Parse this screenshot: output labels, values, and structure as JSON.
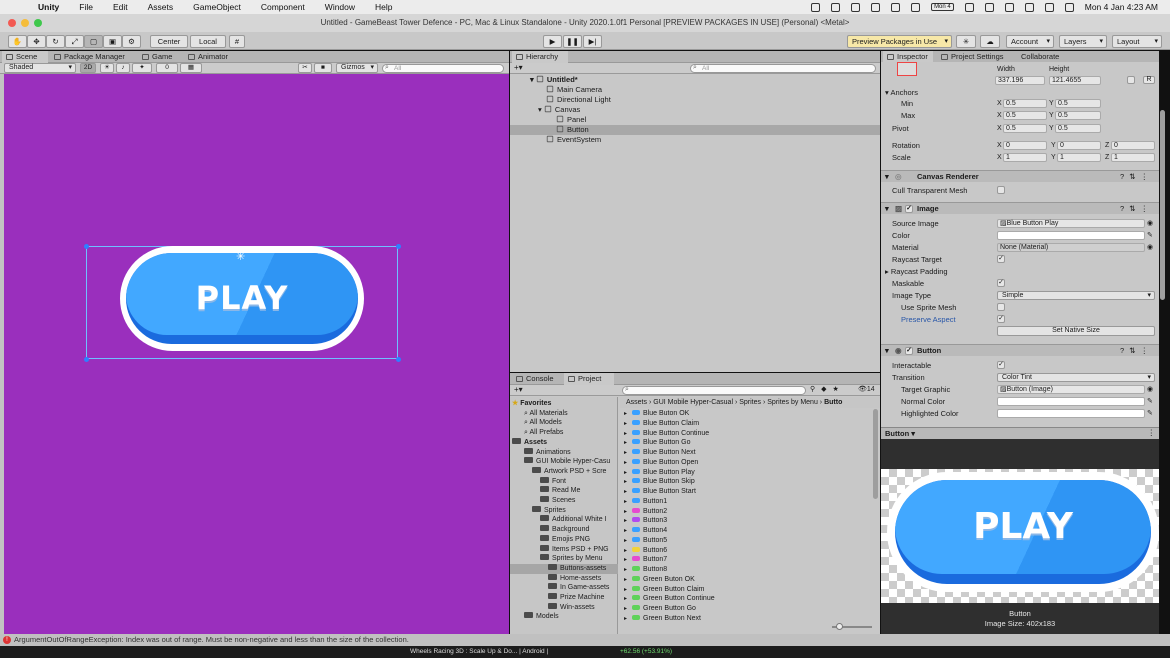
{
  "menubar": {
    "app": "Unity",
    "items": [
      "File",
      "Edit",
      "Assets",
      "GameObject",
      "Component",
      "Window",
      "Help"
    ],
    "badge": "Mon 4",
    "datetime": "Mon 4 Jan  4:23 AM"
  },
  "window": {
    "title": "Untitled - GameBeast Tower Defence - PC, Mac & Linux Standalone - Unity 2020.1.0f1 Personal [PREVIEW PACKAGES IN USE] (Personal) <Metal>"
  },
  "toolbar": {
    "center": "Center",
    "local": "Local",
    "preview_packages": "Preview Packages in Use",
    "account": "Account",
    "layers": "Layers",
    "layout": "Layout"
  },
  "scene_tabs": [
    "Scene",
    "Package Manager",
    "Game",
    "Animator"
  ],
  "scene_bar": {
    "shading": "Shaded",
    "mode2d": "2D",
    "layers_count": "0",
    "gizmos": "Gizmos",
    "search_placeholder": "All"
  },
  "scene_button": {
    "label": "PLAY"
  },
  "hierarchy": {
    "tab": "Hierarchy",
    "search_placeholder": "All",
    "rows": [
      {
        "label": "Untitled*"
      },
      {
        "label": "Main Camera"
      },
      {
        "label": "Directional Light"
      },
      {
        "label": "Canvas"
      },
      {
        "label": "Panel"
      },
      {
        "label": "Button"
      },
      {
        "label": "EventSystem"
      }
    ]
  },
  "project": {
    "tabs": [
      "Console",
      "Project"
    ],
    "count": "14",
    "breadcrumb": [
      "Assets",
      "GUI Mobile Hyper-Casual",
      "Sprites",
      "Sprites by Menu",
      "Butto"
    ],
    "tree": [
      {
        "label": "Favorites"
      },
      {
        "label": "All Materials"
      },
      {
        "label": "All Models"
      },
      {
        "label": "All Prefabs"
      },
      {
        "label": "Assets"
      },
      {
        "label": "Animations"
      },
      {
        "label": "GUI Mobile Hyper-Casu"
      },
      {
        "label": "Artwork PSD + Scre"
      },
      {
        "label": "Font"
      },
      {
        "label": "Read Me"
      },
      {
        "label": "Scenes"
      },
      {
        "label": "Sprites"
      },
      {
        "label": "Additional White I"
      },
      {
        "label": "Background"
      },
      {
        "label": "Emojis PNG"
      },
      {
        "label": "Items PSD + PNG"
      },
      {
        "label": "Sprites by Menu"
      },
      {
        "label": "Buttons-assets"
      },
      {
        "label": "Home-assets"
      },
      {
        "label": "In Game-assets"
      },
      {
        "label": "Prize Machine"
      },
      {
        "label": "Win-assets"
      },
      {
        "label": "Models"
      }
    ],
    "files": [
      {
        "label": "Blue Buton OK",
        "color": "#3aa0ff"
      },
      {
        "label": "Blue Button Claim",
        "color": "#3aa0ff"
      },
      {
        "label": "Blue Button Continue",
        "color": "#3aa0ff"
      },
      {
        "label": "Blue Button Go",
        "color": "#3aa0ff"
      },
      {
        "label": "Blue Button Next",
        "color": "#3aa0ff"
      },
      {
        "label": "Blue Button Open",
        "color": "#3aa0ff"
      },
      {
        "label": "Blue Button Play",
        "color": "#3aa0ff"
      },
      {
        "label": "Blue Button Skip",
        "color": "#3aa0ff"
      },
      {
        "label": "Blue Button Start",
        "color": "#3aa0ff"
      },
      {
        "label": "Button1",
        "color": "#3aa0ff"
      },
      {
        "label": "Button2",
        "color": "#e64bd0"
      },
      {
        "label": "Button3",
        "color": "#b14bf0"
      },
      {
        "label": "Button4",
        "color": "#3aa0ff"
      },
      {
        "label": "Button5",
        "color": "#3aa0ff"
      },
      {
        "label": "Button6",
        "color": "#f2d43a"
      },
      {
        "label": "Button7",
        "color": "#e64bd0"
      },
      {
        "label": "Button8",
        "color": "#5fd25a"
      },
      {
        "label": "Green Buton OK",
        "color": "#5fd25a"
      },
      {
        "label": "Green Button Claim",
        "color": "#5fd25a"
      },
      {
        "label": "Green Button Continue",
        "color": "#5fd25a"
      },
      {
        "label": "Green Button Go",
        "color": "#5fd25a"
      },
      {
        "label": "Green Button Next",
        "color": "#5fd25a"
      }
    ]
  },
  "inspector": {
    "tabs": [
      "Inspector",
      "Project Settings",
      "Collaborate"
    ],
    "width_label": "Width",
    "height_label": "Height",
    "width": "337.196",
    "height": "121.4655",
    "anchors": "Anchors",
    "min": "Min",
    "max": "Max",
    "anchor_min_x": "0.5",
    "anchor_min_y": "0.5",
    "anchor_max_x": "0.5",
    "anchor_max_y": "0.5",
    "pivot": "Pivot",
    "pivot_x": "0.5",
    "pivot_y": "0.5",
    "rotation": "Rotation",
    "rot_x": "0",
    "rot_y": "0",
    "rot_z": "0",
    "scale": "Scale",
    "scale_x": "1",
    "scale_y": "1",
    "scale_z": "1",
    "canvas_renderer": "Canvas Renderer",
    "cull_mesh": "Cull Transparent Mesh",
    "image": "Image",
    "source_image_label": "Source Image",
    "source_image": "Blue Button Play",
    "color_label": "Color",
    "material_label": "Material",
    "material": "None (Material)",
    "raycast_target": "Raycast Target",
    "raycast_padding": "Raycast Padding",
    "maskable": "Maskable",
    "image_type_label": "Image Type",
    "image_type": "Simple",
    "use_sprite_mesh": "Use Sprite Mesh",
    "preserve_aspect": "Preserve Aspect",
    "set_native_size": "Set Native Size",
    "button": "Button",
    "interactable": "Interactable",
    "transition_label": "Transition",
    "transition": "Color Tint",
    "target_graphic_label": "Target Graphic",
    "target_graphic": "Button (Image)",
    "normal_color": "Normal Color",
    "highlighted_color": "Highlighted Color"
  },
  "preview": {
    "dropdown": "Button",
    "label": "PLAY",
    "name": "Button",
    "size": "Image Size: 402x183"
  },
  "status": {
    "message": "ArgumentOutOfRangeException: Index was out of range. Must be non-negative and less than the size of the collection."
  },
  "dock": {
    "text": "Wheels Racing 3D : Scale Up & Do... | Android |",
    "value": "+62.56 (+53.91%)"
  }
}
